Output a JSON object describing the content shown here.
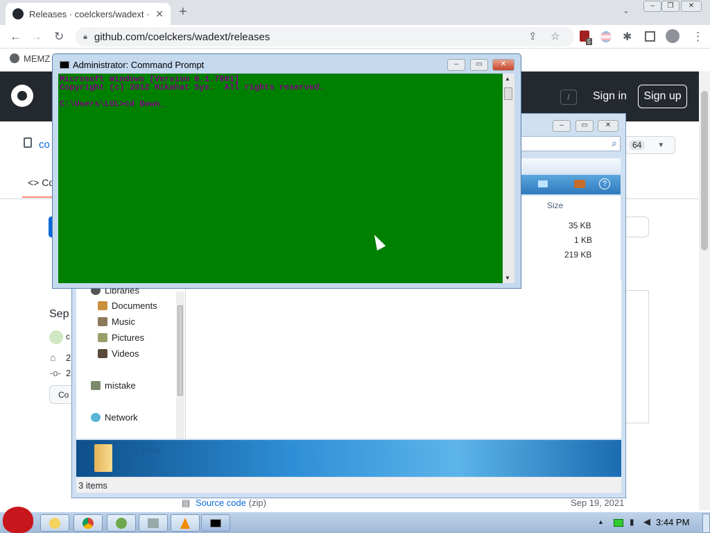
{
  "browser": {
    "tab_title": "Releases · coelckers/wadext · G",
    "new_tab": "+",
    "url": "github.com/coelckers/wadext/releases",
    "bookmark_label": "MEMZ",
    "ext_badge": "5"
  },
  "github": {
    "slash_hint": "/",
    "sign_in": "Sign in",
    "sign_up": "Sign up",
    "repo_prefix": "co",
    "tab_code": "Co",
    "fork_count": "64",
    "sep_label": "Sep",
    "tag_digit": "2",
    "commit_digit": "2",
    "release_btn": "Co",
    "asset_label": "Source code",
    "asset_suffix": "(zip)",
    "asset_date": "Sep 19, 2021"
  },
  "explorer": {
    "col_size": "Size",
    "sizes": [
      "35 KB",
      "1 KB",
      "219 KB"
    ],
    "nav": {
      "libraries": "Libraries",
      "documents": "Documents",
      "music": "Music",
      "pictures": "Pictures",
      "videos": "Videos",
      "mistake": "mistake",
      "network": "Network"
    },
    "banner_items": "3 items",
    "status": "3 items",
    "help": "?"
  },
  "cmd": {
    "title": "Administrator: Command Prompt",
    "line1": "Microsoft Windows [Version 6.1.7601]",
    "line2": "Copyright (c) 2012 Hikahat Sys.  All rights reserved.",
    "prompt": "C:\\Users\\LOL>cd Down_"
  },
  "taskbar": {
    "clock": "3:44 PM"
  }
}
